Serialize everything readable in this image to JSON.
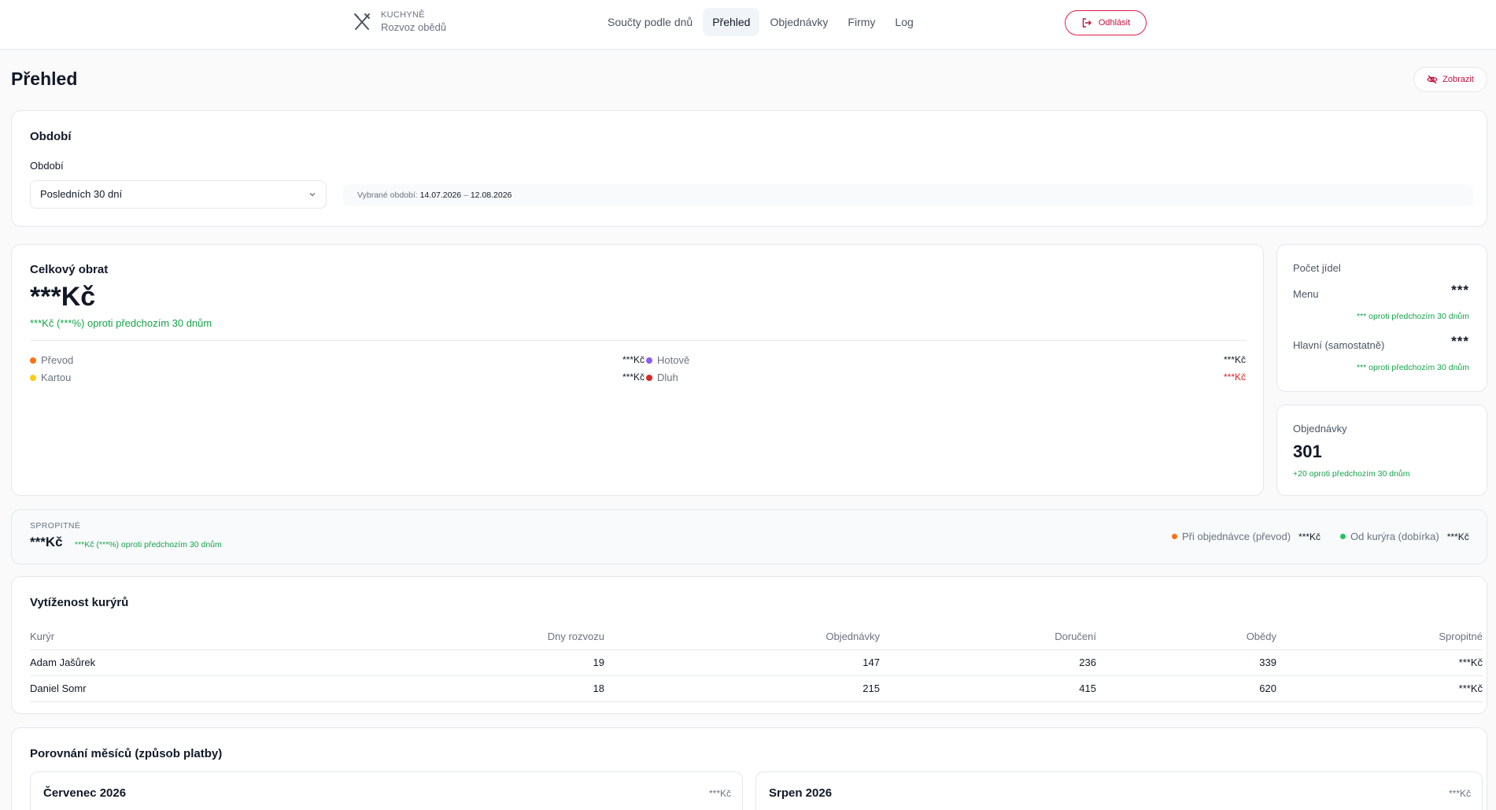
{
  "brand": {
    "top": "KUCHYNĚ",
    "sub": "Rozvoz obědů"
  },
  "nav": [
    "Součty podle dnů",
    "Přehled",
    "Objednávky",
    "Firmy",
    "Log"
  ],
  "logout_label": "Odhlásit",
  "page_title": "Přehled",
  "show_label": "Zobrazit",
  "period": {
    "card_title": "Období",
    "field_label": "Období",
    "selected": "Posledních 30 dní",
    "range_prefix": "Vybrané období:",
    "range_from": "14.07.2026",
    "range_sep": "–",
    "range_to": "12.08.2026"
  },
  "turnover": {
    "title": "Celkový obrat",
    "value": "***Kč",
    "delta": "***Kč (***%) oproti předchozím 30 dnům",
    "payments": [
      {
        "label": "Převod",
        "value": "***Kč",
        "color": "#f97316"
      },
      {
        "label": "Kartou",
        "value": "***Kč",
        "color": "#facc15"
      },
      {
        "label": "Hotově",
        "value": "***Kč",
        "color": "#8b5cf6"
      },
      {
        "label": "Dluh",
        "value": "***Kč",
        "color": "#dc2626"
      }
    ]
  },
  "meals": {
    "title": "Počet jídel",
    "menu_label": "Menu",
    "menu_value": "***",
    "menu_delta": "*** oproti předchozím 30 dnům",
    "main_label": "Hlavní (samostatně)",
    "main_value": "***",
    "main_delta": "*** oproti předchozím 30 dnům"
  },
  "orders": {
    "title": "Objednávky",
    "value": "301",
    "delta": "+20 oproti předchozím 30 dnům"
  },
  "tips": {
    "title": "SPROPITNÉ",
    "value": "***Kč",
    "delta": "***Kč (***%) oproti předchozím 30 dnům",
    "order_label": "Při objednávce (převod)",
    "order_value": "***Kč",
    "order_color": "#f97316",
    "courier_label": "Od kurýra (dobírka)",
    "courier_value": "***Kč",
    "courier_color": "#22c55e"
  },
  "couriers": {
    "title": "Vytíženost kurýrů",
    "headers": [
      "Kurýr",
      "Dny rozvozu",
      "Objednávky",
      "Doručení",
      "Obědy",
      "Spropitné"
    ],
    "rows": [
      [
        "Adam Jašůrek",
        "19",
        "147",
        "236",
        "339",
        "***Kč"
      ],
      [
        "Daniel Somr",
        "18",
        "215",
        "415",
        "620",
        "***Kč"
      ]
    ]
  },
  "comparison": {
    "title": "Porovnání měsíců (způsob platby)",
    "months": [
      {
        "name": "Červenec 2026",
        "value": "***Kč"
      },
      {
        "name": "Srpen 2026",
        "value": "***Kč"
      }
    ]
  }
}
